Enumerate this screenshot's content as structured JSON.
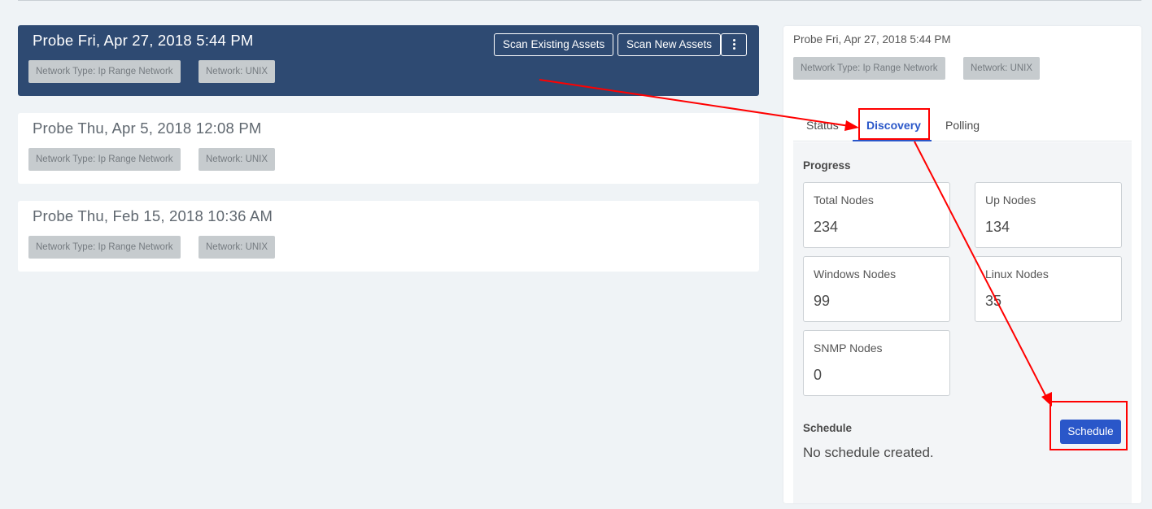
{
  "probes": [
    {
      "title": "Probe Fri, Apr 27, 2018 5:44 PM",
      "tag_network_type": "Network Type: Ip Range Network",
      "tag_network": "Network: UNIX"
    },
    {
      "title": "Probe Thu, Apr 5, 2018 12:08 PM",
      "tag_network_type": "Network Type: Ip Range Network",
      "tag_network": "Network: UNIX"
    },
    {
      "title": "Probe Thu, Feb 15, 2018 10:36 AM",
      "tag_network_type": "Network Type: Ip Range Network",
      "tag_network": "Network: UNIX"
    }
  ],
  "actions": {
    "scan_existing": "Scan Existing Assets",
    "scan_new": "Scan New Assets",
    "more_icon": "vertical-ellipsis-icon"
  },
  "detail": {
    "title": "Probe Fri, Apr 27, 2018 5:44 PM",
    "tag_network_type": "Network Type: Ip Range Network",
    "tag_network": "Network: UNIX",
    "tabs": [
      {
        "label": "Status",
        "active": false
      },
      {
        "label": "Discovery",
        "active": true
      },
      {
        "label": "Polling",
        "active": false
      }
    ],
    "progress": {
      "heading": "Progress",
      "stats": [
        {
          "label": "Total Nodes",
          "value": "234"
        },
        {
          "label": "Up Nodes",
          "value": "134"
        },
        {
          "label": "Windows Nodes",
          "value": "99"
        },
        {
          "label": "Linux Nodes",
          "value": "35"
        },
        {
          "label": "SNMP Nodes",
          "value": "0"
        }
      ]
    },
    "schedule": {
      "heading": "Schedule",
      "empty_text": "No schedule created.",
      "button_label": "Schedule"
    }
  },
  "colors": {
    "selected_card": "#2e4a72",
    "accent": "#2a57c9",
    "annotation": "#ff0000",
    "tag_bg": "#c6cbce",
    "page_bg": "#eff3f6"
  }
}
